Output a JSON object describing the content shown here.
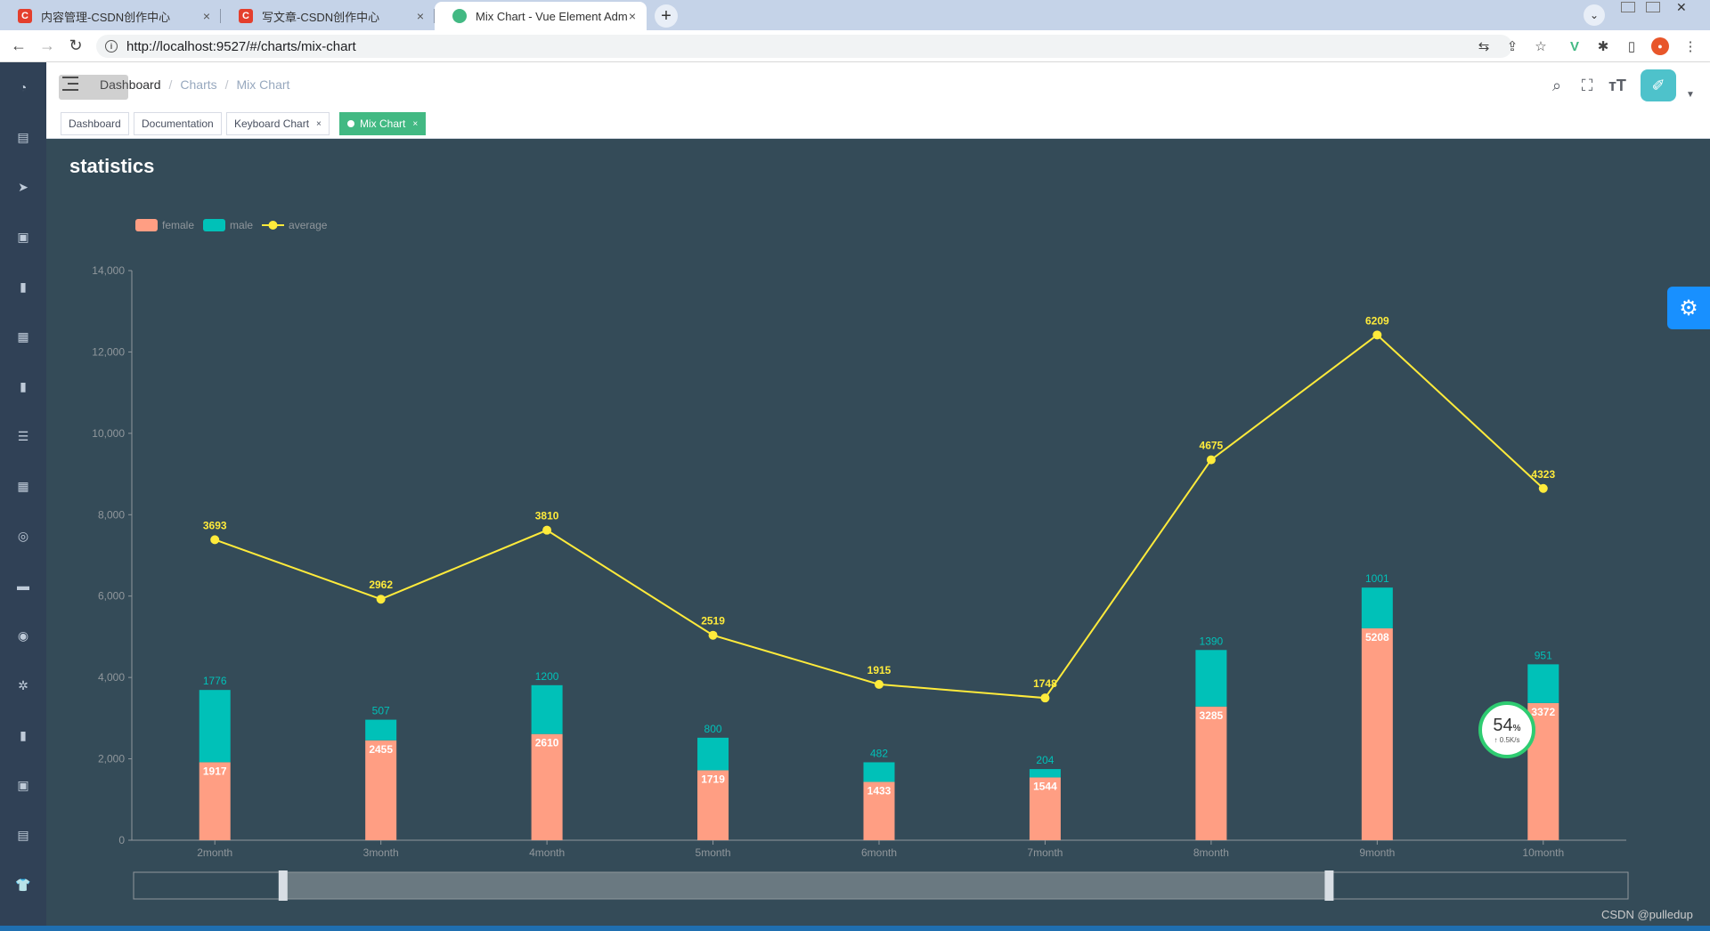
{
  "browser": {
    "tabs": [
      {
        "title": "内容管理-CSDN创作中心",
        "favicon_color": "#e43f2d",
        "favicon_text": "C"
      },
      {
        "title": "写文章-CSDN创作中心",
        "favicon_color": "#e43f2d",
        "favicon_text": "C"
      },
      {
        "title": "Mix Chart - Vue Element Adm",
        "favicon_color": "#42b983",
        "favicon_text": ""
      }
    ],
    "url": "http://localhost:9527/#/charts/mix-chart",
    "newtab_icon": "+",
    "close_icon": "×"
  },
  "navbar": {
    "breadcrumb": [
      "Dashboard",
      "Charts",
      "Mix Chart"
    ],
    "sep": "/"
  },
  "tags": [
    {
      "label": "Dashboard",
      "active": false
    },
    {
      "label": "Documentation",
      "active": false
    },
    {
      "label": "Keyboard Chart",
      "active": false,
      "closable": true
    },
    {
      "label": "Mix Chart",
      "active": true,
      "closable": true
    }
  ],
  "tag_close": "×",
  "sidebar_icons": [
    "dashboard-icon",
    "documentation-icon",
    "guide-icon",
    "permission-icon",
    "icon-icon",
    "component-icon",
    "chart-icon",
    "nested-icon",
    "table-icon",
    "tab-icon",
    "example-icon",
    "error-icon",
    "bug-icon",
    "excel-icon",
    "zip-icon",
    "pdf-icon",
    "theme-icon"
  ],
  "network_monitor": {
    "percent": "54",
    "unit": "%",
    "speed": "↑ 0.5K/s"
  },
  "watermark": "CSDN @pulledup",
  "colors": {
    "female": "#ff9e83",
    "male": "#00c1b8",
    "average": "#ffeb3b",
    "background": "#344b58",
    "accent": "#42b983"
  },
  "chart_data": {
    "type": "bar",
    "title": "statistics",
    "categories": [
      "2month",
      "3month",
      "4month",
      "5month",
      "6month",
      "7month",
      "8month",
      "9month",
      "10month"
    ],
    "series": [
      {
        "name": "female",
        "type": "bar",
        "stack": "total",
        "values": [
          1917,
          2455,
          2610,
          1719,
          1433,
          1544,
          3285,
          5208,
          3372
        ]
      },
      {
        "name": "male",
        "type": "bar",
        "stack": "total",
        "values": [
          1776,
          507,
          1200,
          800,
          482,
          204,
          1390,
          1001,
          951
        ]
      },
      {
        "name": "average",
        "type": "line",
        "values": [
          3693,
          2962,
          3810,
          2519,
          1915,
          1748,
          4675,
          6209,
          4323
        ],
        "plotted_scale": 2
      }
    ],
    "yticks": [
      "0",
      "2,000",
      "4,000",
      "6,000",
      "8,000",
      "10,000",
      "12,000",
      "14,000"
    ],
    "ylim": [
      0,
      14000
    ],
    "grid": false,
    "legend_position": "top-left",
    "datazoom": {
      "start": 10,
      "end": 80
    }
  }
}
